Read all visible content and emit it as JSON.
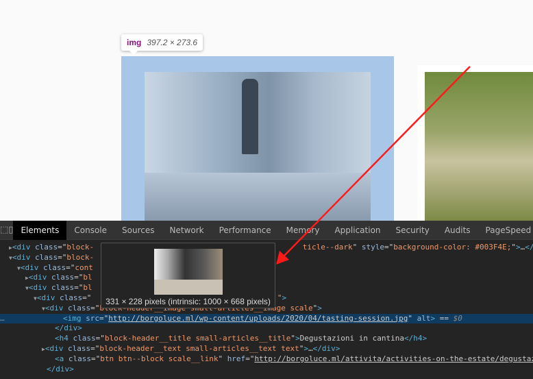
{
  "inspect_tooltip": {
    "tag": "img",
    "dimensions": "397.2 × 273.6"
  },
  "devtools": {
    "tabs": [
      "Elements",
      "Console",
      "Sources",
      "Network",
      "Performance",
      "Memory",
      "Application",
      "Security",
      "Audits",
      "PageSpeed"
    ],
    "active_tab": "Elements",
    "rows": [
      {
        "pre": "▶",
        "parts": [
          [
            "t",
            "<div "
          ],
          [
            "a",
            "class"
          ],
          [
            "x",
            "=\""
          ],
          [
            "v",
            "block-"
          ],
          [
            "x",
            "                                              "
          ],
          [
            "v",
            "ticle--dark"
          ],
          [
            "x",
            "\" "
          ],
          [
            "a",
            "style"
          ],
          [
            "x",
            "=\""
          ],
          [
            "v",
            "background-color: #003F4E;"
          ],
          [
            "x",
            "\""
          ],
          [
            "t",
            ">"
          ],
          [
            "x",
            "…"
          ],
          [
            "t",
            "</div>"
          ]
        ],
        "indent": 22
      },
      {
        "pre": "▼",
        "parts": [
          [
            "t",
            "<div "
          ],
          [
            "a",
            "class"
          ],
          [
            "x",
            "=\""
          ],
          [
            "v",
            "block-"
          ]
        ],
        "indent": 22
      },
      {
        "pre": "▼",
        "parts": [
          [
            "t",
            "<div "
          ],
          [
            "a",
            "class"
          ],
          [
            "x",
            "=\""
          ],
          [
            "v",
            "cont"
          ]
        ],
        "indent": 34
      },
      {
        "pre": "▶",
        "parts": [
          [
            "t",
            "<div "
          ],
          [
            "a",
            "class"
          ],
          [
            "x",
            "=\""
          ],
          [
            "v",
            "bl"
          ]
        ],
        "indent": 46
      },
      {
        "pre": "▼",
        "parts": [
          [
            "t",
            "<div "
          ],
          [
            "a",
            "class"
          ],
          [
            "x",
            "=\""
          ],
          [
            "v",
            "bl"
          ]
        ],
        "indent": 46
      },
      {
        "pre": "▼",
        "parts": [
          [
            "t",
            "<div "
          ],
          [
            "a",
            "class"
          ],
          [
            "x",
            "=\""
          ],
          [
            "x",
            "                                         "
          ],
          [
            "v",
            "\""
          ],
          [
            "t",
            ">"
          ]
        ],
        "indent": 58
      },
      {
        "pre": "▼",
        "parts": [
          [
            "t",
            "<div "
          ],
          [
            "a",
            "class"
          ],
          [
            "x",
            "=\""
          ],
          [
            "v",
            "block-header__image small-articles__image scale"
          ],
          [
            "x",
            "\""
          ],
          [
            "t",
            ">"
          ]
        ],
        "indent": 70
      },
      {
        "pre": "",
        "sel": true,
        "parts": [
          [
            "t",
            "<img "
          ],
          [
            "a",
            "src"
          ],
          [
            "x",
            "=\""
          ],
          [
            "u",
            "http://borgoluce.ml/wp-content/uploads/2020/04/tasting-session.jpg"
          ],
          [
            "x",
            "\" "
          ],
          [
            "a",
            "alt"
          ],
          [
            "t",
            ">"
          ],
          [
            "x",
            " == "
          ],
          [
            "dim",
            "$0"
          ]
        ],
        "indent": 92
      },
      {
        "pre": "",
        "parts": [
          [
            "t",
            "</div>"
          ]
        ],
        "indent": 80
      },
      {
        "pre": "",
        "parts": [
          [
            "t",
            "<h4 "
          ],
          [
            "a",
            "class"
          ],
          [
            "x",
            "=\""
          ],
          [
            "v",
            "block-header__title small-articles__title"
          ],
          [
            "x",
            "\""
          ],
          [
            "t",
            ">"
          ],
          [
            "x",
            "Degustazioni in cantina"
          ],
          [
            "t",
            "</h4>"
          ]
        ],
        "indent": 80
      },
      {
        "pre": "▶",
        "parts": [
          [
            "t",
            "<div "
          ],
          [
            "a",
            "class"
          ],
          [
            "x",
            "=\""
          ],
          [
            "v",
            "block-header__text small-articles__text text"
          ],
          [
            "x",
            "\""
          ],
          [
            "t",
            ">"
          ],
          [
            "x",
            "…"
          ],
          [
            "t",
            "</div>"
          ]
        ],
        "indent": 70
      },
      {
        "pre": "",
        "parts": [
          [
            "t",
            "<a "
          ],
          [
            "a",
            "class"
          ],
          [
            "x",
            "=\""
          ],
          [
            "v",
            "btn btn--block scale__link"
          ],
          [
            "x",
            "\" "
          ],
          [
            "a",
            "href"
          ],
          [
            "x",
            "=\""
          ],
          [
            "u",
            "http://borgoluce.ml/attivita/activities-on-the-estate/degustazioni"
          ]
        ],
        "indent": 80
      },
      {
        "pre": "",
        "parts": [
          [
            "t",
            "</div>"
          ]
        ],
        "indent": 68
      }
    ],
    "image_preview": {
      "caption": "331 × 228 pixels (intrinsic: 1000 × 668 pixels)"
    }
  },
  "colors": {
    "highlight": "#a8c7e8",
    "selected_row": "#0e3b5f",
    "annotation_arrow": "#ff1a1a"
  }
}
